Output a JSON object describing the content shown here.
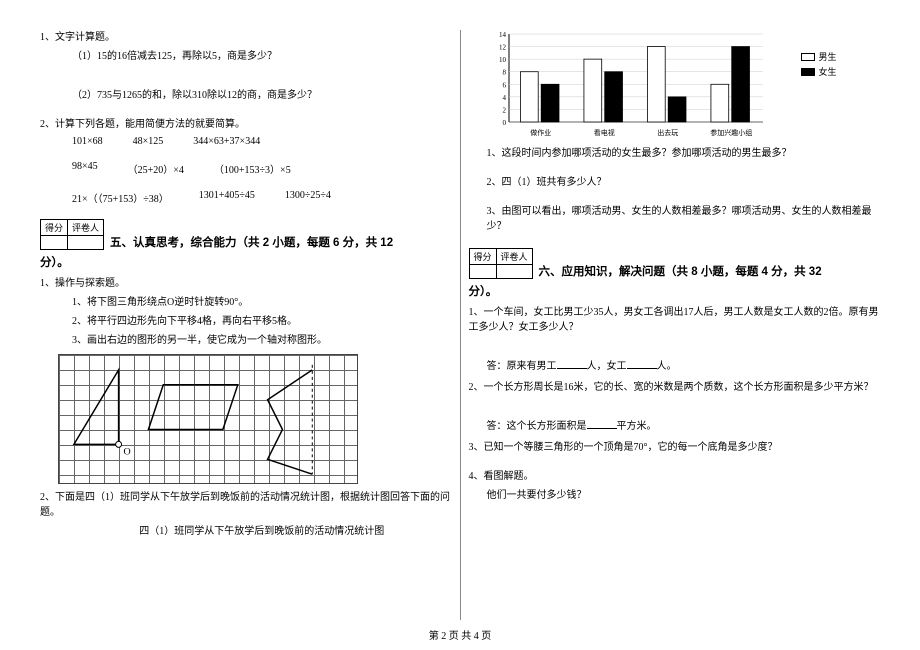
{
  "left": {
    "q1_head": "1、文字计算题。",
    "q1_a": "（1）15的16倍减去125，再除以5，商是多少？",
    "q1_b": "（2）735与1265的和，除以310除以12的商，商是多少？",
    "q2_head": "2、计算下列各题，能用简便方法的就要简算。",
    "q2_row1": [
      "101×68",
      "48×125",
      "344×63+37×344"
    ],
    "q2_row2": [
      "98×45",
      "（25+20）×4",
      "（100+153÷3）×5"
    ],
    "q2_row3": [
      "21×（（75+153）÷38）",
      "1301+405÷45",
      "1300÷25÷4"
    ],
    "score_cells": [
      "得分",
      "评卷人"
    ],
    "sec5_title": "五、认真思考，综合能力（共 2 小题，每题 6 分，共 12",
    "sec5_title_cont": "分）。",
    "p1_head": "1、操作与探索题。",
    "p1_a": "1、将下图三角形绕点O逆时针旋转90°。",
    "p1_b": "2、将平行四边形先向下平移4格，再向右平移5格。",
    "p1_c": "3、画出右边的图形的另一半，使它成为一个轴对称图形。",
    "p2_head": "2、下面是四（1）班同学从下午放学后到晚饭前的活动情况统计图，根据统计图回答下面的问题。",
    "p2_caption": "四（1）班同学从下午放学后到晚饭前的活动情况统计图"
  },
  "right": {
    "chart_data": {
      "type": "bar",
      "categories": [
        "做作业",
        "看电视",
        "出去玩",
        "参加兴趣小组"
      ],
      "series": [
        {
          "name": "男生",
          "values": [
            8,
            10,
            12,
            6
          ],
          "fill": "#fff"
        },
        {
          "name": "女生",
          "values": [
            6,
            8,
            4,
            12
          ],
          "fill": "#000"
        }
      ],
      "ylim": [
        0,
        14
      ],
      "ticks": [
        0,
        2,
        4,
        6,
        8,
        10,
        12,
        14
      ],
      "legend": [
        "男生",
        "女生"
      ]
    },
    "rq1": "1、这段时间内参加哪项活动的女生最多？参加哪项活动的男生最多？",
    "rq2": "2、四（1）班共有多少人？",
    "rq3": "3、由图可以看出，哪项活动男、女生的人数相差最多？哪项活动男、女生的人数相差最少？",
    "score_cells": [
      "得分",
      "评卷人"
    ],
    "sec6_title": "六、应用知识，解决问题（共 8 小题，每题 4 分，共 32",
    "sec6_title_cont": "分）。",
    "w1": "1、一个车间，女工比男工少35人，男女工各调出17人后，男工人数是女工人数的2倍。原有男工多少人？女工多少人？",
    "w1_ans_prefix": "答：原来有男工",
    "w1_ans_mid": "人，女工",
    "w1_ans_suffix": "人。",
    "w2": "2、一个长方形周长是16米，它的长、宽的米数是两个质数，这个长方形面积是多少平方米？",
    "w2_ans_prefix": "答：这个长方形面积是",
    "w2_ans_suffix": "平方米。",
    "w3": "3、已知一个等腰三角形的一个顶角是70°，它的每一个底角是多少度？",
    "w4_a": "4、看图解题。",
    "w4_b": "他们一共要付多少钱？"
  },
  "footer": "第 2 页  共 4 页"
}
